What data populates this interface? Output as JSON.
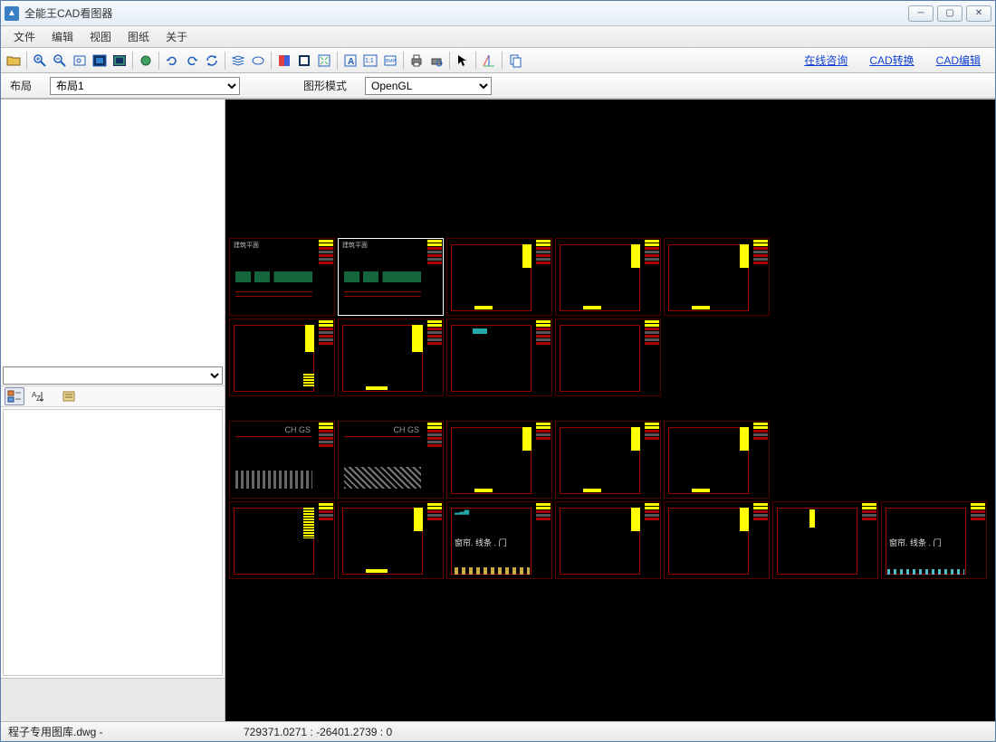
{
  "window": {
    "title": "全能王CAD看图器"
  },
  "menubar": [
    "文件",
    "编辑",
    "视图",
    "图纸",
    "关于"
  ],
  "toolbar_links": {
    "consult": "在线咨询",
    "convert": "CAD转换",
    "edit": "CAD编辑"
  },
  "optbar": {
    "layout_label": "布局",
    "layout_value": "布局1",
    "mode_label": "图形模式",
    "mode_value": "OpenGL"
  },
  "sidepanel": {
    "combo_value": "",
    "view_cat": "分类",
    "view_az": "A-Z",
    "view_list": "列表"
  },
  "canvas": {
    "thumb_label_small": "建筑平面",
    "chgs_label": "CH GS",
    "annotation_text": "窗帘. 线条 . 门"
  },
  "status": {
    "file": "程子专用图库.dwg -",
    "coord": "729371.0271 : -26401.2739 : 0"
  },
  "colors": {
    "accent": "#1040d0",
    "frame": "#990000"
  }
}
